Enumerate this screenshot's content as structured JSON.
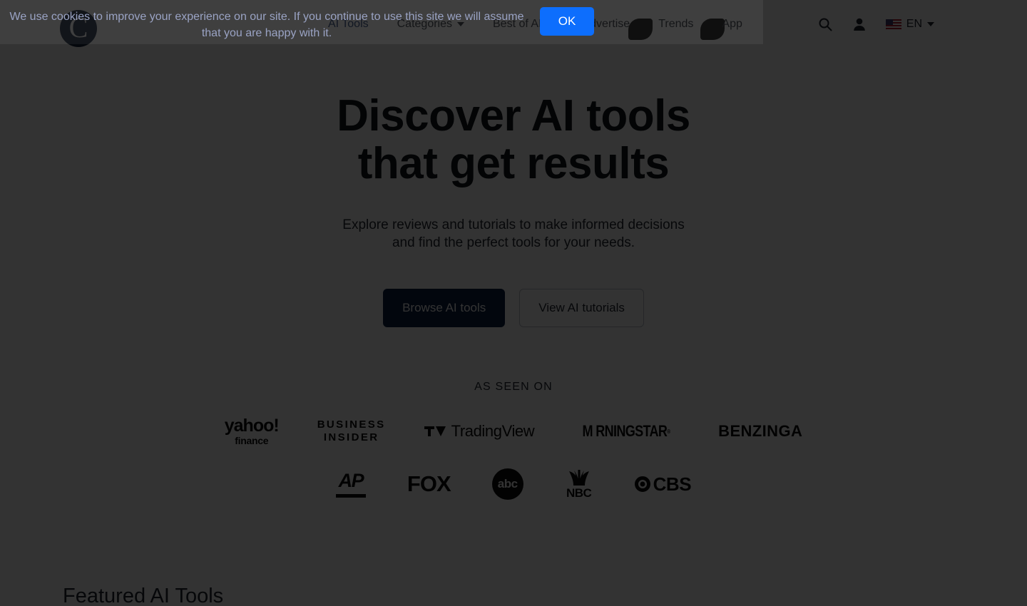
{
  "header": {
    "logo_letter": "C",
    "logo_name": "circular-c-logo",
    "nav": [
      {
        "label": "AI Tools",
        "has_caret": false,
        "active": true
      },
      {
        "label": "Categories",
        "has_caret": true,
        "active": false
      },
      {
        "label": "Best of AI",
        "has_caret": true,
        "active": false
      },
      {
        "label": "Advertise",
        "has_caret": false,
        "active": false
      },
      {
        "label": "Trends",
        "has_caret": false,
        "active": false
      },
      {
        "label": "App",
        "has_caret": false,
        "active": false
      }
    ],
    "search_icon": "search-icon",
    "account_icon": "user-account-icon",
    "language": "EN",
    "language_flag": "us-flag-icon"
  },
  "hero": {
    "title_line1": "Discover AI tools",
    "title_line2": "that get results",
    "subtitle_line1": "Explore reviews and tutorials to make informed decisions",
    "subtitle_line2": "and find the perfect tools for your needs.",
    "primary_button": "Browse AI tools",
    "secondary_button": "View AI tutorials"
  },
  "press": {
    "label": "AS SEEN ON",
    "row1": [
      {
        "name": "yahoo-finance-logo",
        "main": "yahoo!",
        "sub": "finance"
      },
      {
        "name": "business-insider-logo",
        "line1": "BUSINESS",
        "line2": "INSIDER"
      },
      {
        "name": "tradingview-logo",
        "text": "TradingView"
      },
      {
        "name": "morningstar-logo",
        "text": "M RNINGSTAR",
        "mark": "®"
      },
      {
        "name": "benzinga-logo",
        "text": "BENZINGA"
      }
    ],
    "row2": [
      {
        "name": "associated-press-logo",
        "text": "AP"
      },
      {
        "name": "fox-logo",
        "text": "FOX"
      },
      {
        "name": "abc-logo",
        "text": "abc"
      },
      {
        "name": "nbc-logo",
        "text": "NBC"
      },
      {
        "name": "cbs-logo",
        "text": "CBS"
      }
    ]
  },
  "featured": {
    "title": "Featured AI Tools"
  },
  "cookie": {
    "message": "We use cookies to improve your experience on our site. If you continue to use this site we will assume that you are happy with it.",
    "ok_label": "OK",
    "ok_color": "#0d6efd"
  },
  "colors": {
    "brand_navy": "#0b1f44",
    "accent_blue": "#0d6efd",
    "page_background": "#ffffff",
    "overlay": "rgba(0,0,0,0.80)"
  }
}
